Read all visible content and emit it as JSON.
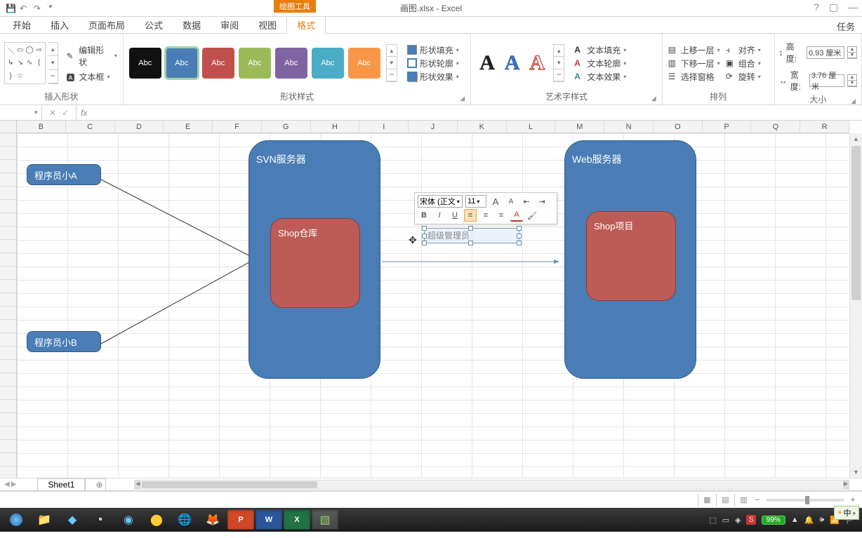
{
  "titlebar": {
    "context_tab": "绘图工具",
    "title": "画图.xlsx - Excel",
    "help": "?"
  },
  "tabs": {
    "items": [
      "开始",
      "插入",
      "页面布局",
      "公式",
      "数据",
      "审阅",
      "视图",
      "格式"
    ],
    "active_index": 7,
    "right": "任务"
  },
  "ribbon": {
    "insert_shapes": {
      "edit_shape": "编辑形状",
      "text_box": "文本框",
      "label": "插入形状"
    },
    "shape_styles": {
      "thumbs": [
        {
          "bg": "#111111"
        },
        {
          "bg": "#4a7db5"
        },
        {
          "bg": "#c0504d"
        },
        {
          "bg": "#9bbb59"
        },
        {
          "bg": "#8064a2"
        },
        {
          "bg": "#4bacc6"
        },
        {
          "bg": "#f79646"
        }
      ],
      "thumb_label": "Abc",
      "selected_index": 1,
      "fill": "形状填充",
      "outline": "形状轮廓",
      "effects": "形状效果",
      "label": "形状样式"
    },
    "wordart": {
      "text_fill": "文本填充",
      "text_outline": "文本轮廓",
      "text_effects": "文本效果",
      "label": "艺术字样式",
      "sample": "A"
    },
    "arrange": {
      "bring_forward": "上移一层",
      "send_backward": "下移一层",
      "selection_pane": "选择窗格",
      "align": "对齐",
      "group": "组合",
      "rotate": "旋转",
      "label": "排列"
    },
    "size": {
      "height_label": "高度:",
      "height_value": "0.93 厘米",
      "width_label": "宽度:",
      "width_value": "3.76 厘米",
      "label": "大小"
    }
  },
  "formula_bar": {
    "namebox": "",
    "cancel": "✕",
    "enter": "✓",
    "fx": "fx"
  },
  "columns": [
    "B",
    "C",
    "D",
    "E",
    "F",
    "G",
    "H",
    "I",
    "J",
    "K",
    "L",
    "M",
    "N",
    "O",
    "P",
    "Q",
    "R"
  ],
  "diagram": {
    "prog_a": "程序员小A",
    "prog_b": "程序员小B",
    "svn_server": "SVN服务器",
    "shop_repo": "Shop仓库",
    "web_server": "Web服务器",
    "shop_proj": "Shop项目",
    "sel_text": "超级管理员"
  },
  "mini_toolbar": {
    "font": "宋体 (正文",
    "size": "11"
  },
  "sheet_tabs": {
    "sheet": "Sheet1"
  },
  "statusbar": {
    "zoom": "99%"
  },
  "lang_indicator": "中",
  "taskbar": {
    "battery": "99%",
    "time": ""
  }
}
